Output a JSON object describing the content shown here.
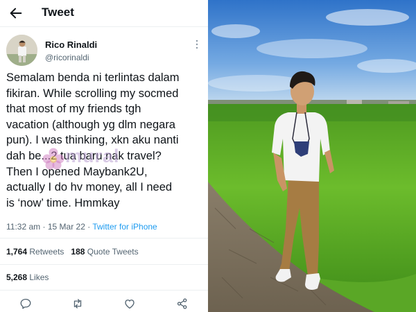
{
  "header": {
    "title": "Tweet"
  },
  "author": {
    "name": "Rico Rinaldi",
    "handle": "@ricorinaldi"
  },
  "tweet": {
    "lines": [
      "Semalam benda ni terlintas dalam",
      "fikiran. While scrolling my socmed",
      "that most of my friends tgh",
      "vacation (although yg dlm negara",
      "pun). I was thinking, xkn aku nanti",
      "dah be...2 tua baru nak travel?",
      "Then I opened Maybank2U,",
      "actually I do hv money, all I need",
      "is ‘now’ time. Hmmkay"
    ],
    "time": "11:32 am",
    "separator": "·",
    "date": "15 Mar 22",
    "source": "Twitter for iPhone"
  },
  "stats": {
    "retweets_count": "1,764",
    "retweets_label": "Retweets",
    "quotes_count": "188",
    "quotes_label": "Quote Tweets",
    "likes_count": "5,268",
    "likes_label": "Likes"
  },
  "watermark": {
    "text": "mural"
  },
  "icons": {
    "back": "arrow-left-icon",
    "more": "more-vertical-icon",
    "reply": "reply-icon",
    "retweet": "retweet-icon",
    "like": "heart-icon",
    "share": "share-icon"
  },
  "colors": {
    "text": "#0f1419",
    "secondary": "#536471",
    "link": "#1d9bf0",
    "divider": "#eceff1"
  }
}
